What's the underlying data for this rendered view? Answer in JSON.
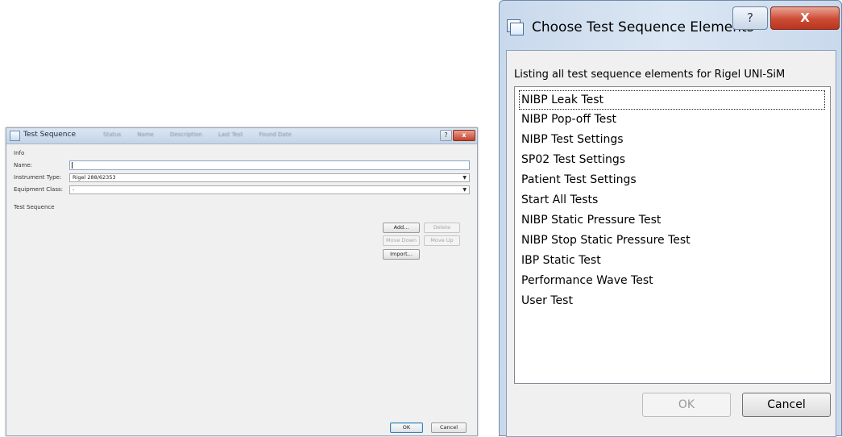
{
  "test_sequence_window": {
    "title": "Test Sequence",
    "blurred_headers": [
      "Status",
      "Name",
      "Description",
      "Last Test",
      "Found Date"
    ],
    "help_glyph": "?",
    "close_glyph": "x",
    "info_label": "Info",
    "name_label": "Name:",
    "name_value": "",
    "instrument_type_label": "Instrument Type:",
    "instrument_type_value": "Rigel 288/62353",
    "equipment_class_label": "Equipment Class:",
    "equipment_class_value": "-",
    "test_sequence_label": "Test Sequence",
    "buttons": {
      "add": "Add...",
      "delete": "Delete",
      "move_down": "Move Down",
      "move_up": "Move Up",
      "import": "Import...",
      "ok": "OK",
      "cancel": "Cancel"
    },
    "dropdown_glyph": "▼"
  },
  "choose_dialog": {
    "title": "Choose Test Sequence Elements",
    "help_glyph": "?",
    "close_glyph": "X",
    "description": "Listing all test sequence elements for Rigel UNI-SiM",
    "items": [
      "NIBP Leak Test",
      "NIBP Pop-off Test",
      "NIBP Test Settings",
      "SP02 Test Settings",
      "Patient Test Settings",
      "Start All Tests",
      "NIBP Static Pressure Test",
      "NIBP Stop Static Pressure Test",
      "IBP Static Test",
      "Performance Wave Test",
      "User Test"
    ],
    "ok_label": "OK",
    "cancel_label": "Cancel"
  }
}
